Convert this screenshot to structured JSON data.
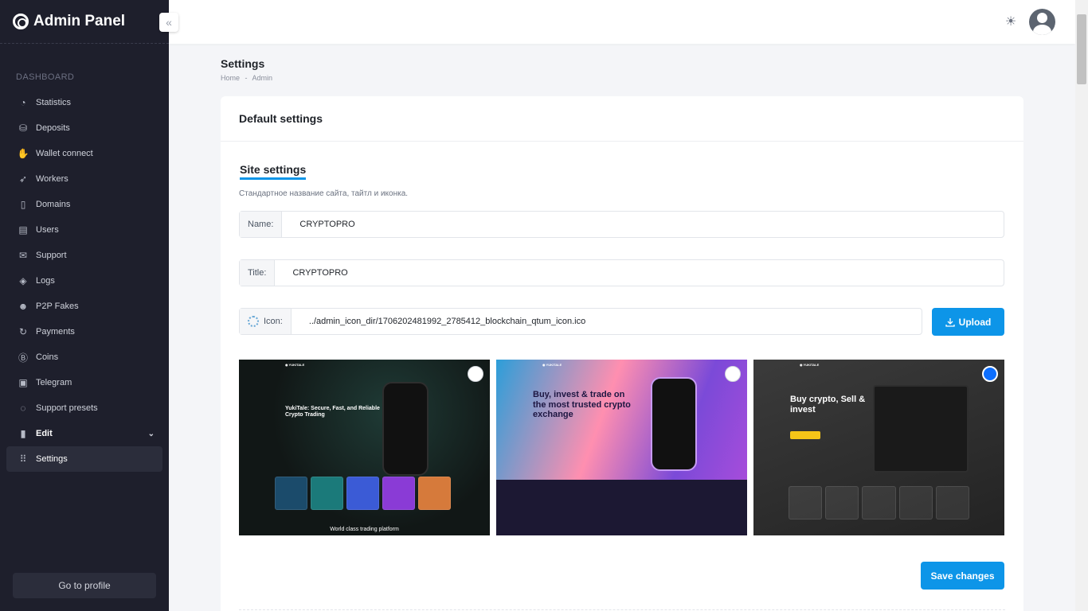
{
  "sidebar": {
    "brand": "Admin Panel",
    "section_label": "DASHBOARD",
    "items": [
      {
        "label": "Statistics",
        "icon": "pie-chart-icon"
      },
      {
        "label": "Deposits",
        "icon": "coins-icon"
      },
      {
        "label": "Wallet connect",
        "icon": "wallet-icon"
      },
      {
        "label": "Workers",
        "icon": "rocket-icon"
      },
      {
        "label": "Domains",
        "icon": "map-icon"
      },
      {
        "label": "Users",
        "icon": "users-icon"
      },
      {
        "label": "Support",
        "icon": "envelope-icon"
      },
      {
        "label": "Logs",
        "icon": "layers-icon"
      },
      {
        "label": "P2P Fakes",
        "icon": "user-secret-icon"
      },
      {
        "label": "Payments",
        "icon": "refresh-icon"
      },
      {
        "label": "Coins",
        "icon": "bitcoin-icon"
      },
      {
        "label": "Telegram",
        "icon": "telegram-icon"
      },
      {
        "label": "Support presets",
        "icon": "chat-icon"
      },
      {
        "label": "Edit",
        "icon": "edit-icon"
      },
      {
        "label": "Settings",
        "icon": "grid-icon"
      }
    ],
    "goto_profile": "Go to profile"
  },
  "page": {
    "title": "Settings",
    "breadcrumb": [
      "Home",
      "-",
      "Admin"
    ]
  },
  "card": {
    "header": "Default settings",
    "section_title": "Site settings",
    "section_desc": "Стандартное название сайта, тайтл и иконка.",
    "name_label": "Name:",
    "name_value": "CRYPTOPRO",
    "title_label": "Title:",
    "title_value": "CRYPTOPRO",
    "icon_label": "Icon:",
    "icon_value": "../admin_icon_dir/1706202481992_2785412_blockchain_qtum_icon.ico",
    "upload_label": "Upload",
    "save_label": "Save changes"
  },
  "previews": [
    {
      "heading": "YukiTale: Secure, Fast, and Reliable Crypto Trading",
      "footer": "World class trading platform",
      "selected": false
    },
    {
      "heading": "Buy, invest & trade on the most trusted crypto exchange",
      "selected": false
    },
    {
      "heading": "Buy crypto, Sell & invest",
      "selected": true
    }
  ],
  "colors": {
    "sidebar_bg": "#1e1f2c",
    "accent": "#0d95e8",
    "page_bg": "#f4f5f8"
  }
}
